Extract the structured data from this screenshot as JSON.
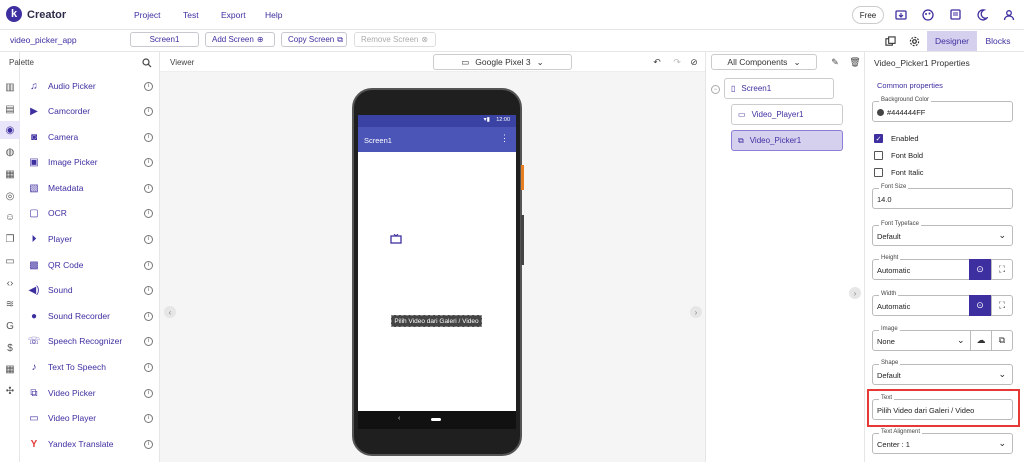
{
  "app": {
    "logo_letter": "k",
    "name": "Creator"
  },
  "menu": [
    "Project",
    "Test",
    "Export",
    "Help"
  ],
  "top_right": {
    "free_label": "Free"
  },
  "project": {
    "app_name": "video_picker_app"
  },
  "toolbar": {
    "screen_label": "Screen1",
    "add_screen_label": "Add Screen",
    "copy_screen_label": "Copy Screen",
    "remove_screen_label": "Remove Screen",
    "designer_label": "Designer",
    "blocks_label": "Blocks"
  },
  "palette": {
    "title": "Palette",
    "items": [
      {
        "label": "Audio Picker",
        "icon": "audio-picker-icon"
      },
      {
        "label": "Camcorder",
        "icon": "camcorder-icon"
      },
      {
        "label": "Camera",
        "icon": "camera-icon"
      },
      {
        "label": "Image Picker",
        "icon": "image-picker-icon"
      },
      {
        "label": "Metadata",
        "icon": "metadata-icon"
      },
      {
        "label": "OCR",
        "icon": "ocr-icon"
      },
      {
        "label": "Player",
        "icon": "player-icon"
      },
      {
        "label": "QR Code",
        "icon": "qr-code-icon"
      },
      {
        "label": "Sound",
        "icon": "sound-icon"
      },
      {
        "label": "Sound Recorder",
        "icon": "sound-recorder-icon"
      },
      {
        "label": "Speech Recognizer",
        "icon": "speech-recognizer-icon"
      },
      {
        "label": "Text To Speech",
        "icon": "text-to-speech-icon"
      },
      {
        "label": "Video Picker",
        "icon": "video-picker-icon"
      },
      {
        "label": "Video Player",
        "icon": "video-player-icon"
      },
      {
        "label": "Yandex Translate",
        "icon": "yandex-translate-icon"
      }
    ]
  },
  "viewer": {
    "title": "Viewer",
    "device": "Google Pixel 3",
    "phone": {
      "status_time": "12:00",
      "screen_title": "Screen1",
      "button_text": "Pilih Video dari Galeri / Video"
    }
  },
  "components": {
    "filter": "All Components",
    "tree": [
      {
        "label": "Screen1",
        "selected": false
      },
      {
        "label": "Video_Player1",
        "selected": false
      },
      {
        "label": "Video_Picker1",
        "selected": true
      }
    ]
  },
  "properties": {
    "title": "Video_Picker1 Properties",
    "section": "Common properties",
    "background_color": {
      "label": "Background Color",
      "value": "#444444FF",
      "swatch": "#444444"
    },
    "enabled": {
      "label": "Enabled",
      "checked": true
    },
    "font_bold": {
      "label": "Font Bold",
      "checked": false
    },
    "font_italic": {
      "label": "Font Italic",
      "checked": false
    },
    "font_size": {
      "label": "Font Size",
      "value": "14.0"
    },
    "font_typeface": {
      "label": "Font Typeface",
      "value": "Default"
    },
    "height": {
      "label": "Height",
      "value": "Automatic"
    },
    "width": {
      "label": "Width",
      "value": "Automatic"
    },
    "image": {
      "label": "Image",
      "value": "None"
    },
    "shape": {
      "label": "Shape",
      "value": "Default"
    },
    "text": {
      "label": "Text",
      "value": "Pilih Video dari Galeri / Video"
    },
    "text_alignment": {
      "label": "Text Alignment",
      "value": "Center : 1"
    }
  },
  "colors": {
    "accent": "#3d2fa0",
    "selected_bg": "#d6d0ef",
    "highlight_box": "#e53935",
    "appbar": "#4b55b7"
  }
}
